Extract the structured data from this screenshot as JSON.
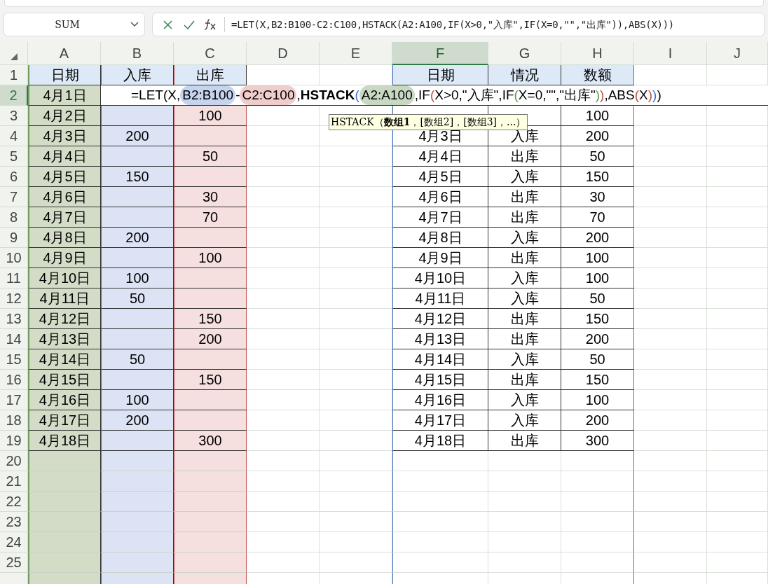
{
  "name_box": {
    "value": "SUM"
  },
  "formula_bar": {
    "value": "=LET(X,B2:B100-C2:C100,HSTACK(A2:A100,IF(X>0,\"入库\",IF(X=0,\"\",\"出库\")),ABS(X)))"
  },
  "columns": [
    {
      "label": "A",
      "selected": false
    },
    {
      "label": "B",
      "selected": false
    },
    {
      "label": "C",
      "selected": false
    },
    {
      "label": "D",
      "selected": false
    },
    {
      "label": "E",
      "selected": false
    },
    {
      "label": "F",
      "selected": true
    },
    {
      "label": "G",
      "selected": false
    },
    {
      "label": "H",
      "selected": false
    },
    {
      "label": "I",
      "selected": false
    },
    {
      "label": "J",
      "selected": false
    }
  ],
  "rows": [
    {
      "label": "1",
      "selected": false
    },
    {
      "label": "2",
      "selected": true
    },
    {
      "label": "3",
      "selected": false
    },
    {
      "label": "4",
      "selected": false
    },
    {
      "label": "5",
      "selected": false
    },
    {
      "label": "6",
      "selected": false
    },
    {
      "label": "7",
      "selected": false
    },
    {
      "label": "8",
      "selected": false
    },
    {
      "label": "9",
      "selected": false
    },
    {
      "label": "10",
      "selected": false
    },
    {
      "label": "11",
      "selected": false
    },
    {
      "label": "12",
      "selected": false
    },
    {
      "label": "13",
      "selected": false
    },
    {
      "label": "14",
      "selected": false
    },
    {
      "label": "15",
      "selected": false
    },
    {
      "label": "16",
      "selected": false
    },
    {
      "label": "17",
      "selected": false
    },
    {
      "label": "18",
      "selected": false
    },
    {
      "label": "19",
      "selected": false
    },
    {
      "label": "20",
      "selected": false
    },
    {
      "label": "21",
      "selected": false
    },
    {
      "label": "22",
      "selected": false
    },
    {
      "label": "23",
      "selected": false
    },
    {
      "label": "24",
      "selected": false
    },
    {
      "label": "25",
      "selected": false
    }
  ],
  "left_table": {
    "headers": [
      "日期",
      "入库",
      "出库"
    ],
    "rows": [
      {
        "date": "4月1日"
      },
      {
        "date": "4月2日",
        "out": "100"
      },
      {
        "date": "4月3日",
        "in": "200"
      },
      {
        "date": "4月4日",
        "out": "50"
      },
      {
        "date": "4月5日",
        "in": "150"
      },
      {
        "date": "4月6日",
        "out": "30"
      },
      {
        "date": "4月7日",
        "out": "70"
      },
      {
        "date": "4月8日",
        "in": "200"
      },
      {
        "date": "4月9日",
        "out": "100"
      },
      {
        "date": "4月10日",
        "in": "100"
      },
      {
        "date": "4月11日",
        "in": "50"
      },
      {
        "date": "4月12日",
        "out": "150"
      },
      {
        "date": "4月13日",
        "out": "200"
      },
      {
        "date": "4月14日",
        "in": "50"
      },
      {
        "date": "4月15日",
        "out": "150"
      },
      {
        "date": "4月16日",
        "in": "100"
      },
      {
        "date": "4月17日",
        "in": "200"
      },
      {
        "date": "4月18日",
        "out": "300"
      }
    ]
  },
  "cell_formula": [
    {
      "kind": "text",
      "text": "=LET(X, "
    },
    {
      "kind": "ref",
      "text": "B2:B100",
      "color": "#c7d4ee"
    },
    {
      "kind": "text",
      "text": "-"
    },
    {
      "kind": "ref",
      "text": "C2:C100",
      "color": "#f1cccc"
    },
    {
      "kind": "text",
      "text": ","
    },
    {
      "kind": "bold",
      "text": "HSTACK"
    },
    {
      "kind": "paren",
      "text": "(",
      "color": "#3b6fd4"
    },
    {
      "kind": "ref",
      "text": "A2:A100",
      "color": "#c9d8c3"
    },
    {
      "kind": "text",
      "text": ",IF"
    },
    {
      "kind": "paren",
      "text": "(",
      "color": "#c0504d"
    },
    {
      "kind": "text",
      "text": "X>0,\"入库\",IF"
    },
    {
      "kind": "paren",
      "text": "(",
      "color": "#5b9b4b"
    },
    {
      "kind": "text",
      "text": "X=0,\"\",\"出库\""
    },
    {
      "kind": "paren",
      "text": ")",
      "color": "#5b9b4b"
    },
    {
      "kind": "paren",
      "text": ")",
      "color": "#c0504d"
    },
    {
      "kind": "text",
      "text": ",ABS"
    },
    {
      "kind": "paren",
      "text": "(",
      "color": "#c0504d"
    },
    {
      "kind": "text",
      "text": "X"
    },
    {
      "kind": "paren",
      "text": ")",
      "color": "#c0504d"
    },
    {
      "kind": "paren",
      "text": ")",
      "color": "#3b6fd4"
    },
    {
      "kind": "text",
      "text": ")"
    }
  ],
  "tooltip": "HSTACK（**数组1**，[数组2]，[数组3]，...）",
  "right_table": {
    "headers": [
      "日期",
      "情况",
      "数额"
    ],
    "rows": [
      {
        "amount": "100"
      },
      {
        "date": "4月3日",
        "status": "入库",
        "amount": "200"
      },
      {
        "date": "4月4日",
        "status": "出库",
        "amount": "50"
      },
      {
        "date": "4月5日",
        "status": "入库",
        "amount": "150"
      },
      {
        "date": "4月6日",
        "status": "出库",
        "amount": "30"
      },
      {
        "date": "4月7日",
        "status": "出库",
        "amount": "70"
      },
      {
        "date": "4月8日",
        "status": "入库",
        "amount": "200"
      },
      {
        "date": "4月9日",
        "status": "出库",
        "amount": "100"
      },
      {
        "date": "4月10日",
        "status": "入库",
        "amount": "100"
      },
      {
        "date": "4月11日",
        "status": "入库",
        "amount": "50"
      },
      {
        "date": "4月12日",
        "status": "出库",
        "amount": "150"
      },
      {
        "date": "4月13日",
        "status": "出库",
        "amount": "200"
      },
      {
        "date": "4月14日",
        "status": "入库",
        "amount": "50"
      },
      {
        "date": "4月15日",
        "status": "出库",
        "amount": "150"
      },
      {
        "date": "4月16日",
        "status": "入库",
        "amount": "100"
      },
      {
        "date": "4月17日",
        "status": "入库",
        "amount": "200"
      },
      {
        "date": "4月18日",
        "status": "出库",
        "amount": "300"
      }
    ]
  }
}
